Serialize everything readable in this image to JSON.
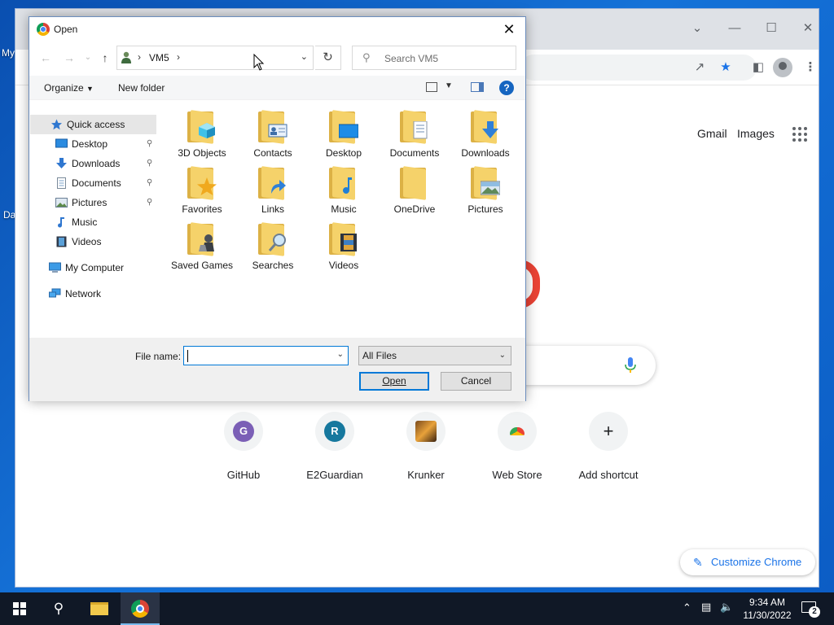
{
  "desktop": {
    "frag1": "My",
    "frag2": "Da"
  },
  "chrome": {
    "ntp": {
      "gmail": "Gmail",
      "images": "Images"
    },
    "shortcuts": [
      {
        "label": "GitHub",
        "letter": "G",
        "color": "#7b5fb6"
      },
      {
        "label": "E2Guardian",
        "letter": "R",
        "color": "#16789e"
      },
      {
        "label": "Krunker",
        "letter": "",
        "color": "#c77a2a"
      },
      {
        "label": "Web Store",
        "letter": "",
        "color": "#ea4335"
      },
      {
        "label": "Add shortcut",
        "letter": "+",
        "color": ""
      }
    ],
    "customize": "Customize Chrome"
  },
  "dialog": {
    "title": "Open",
    "address": {
      "crumb": "VM5"
    },
    "search_placeholder": "Search VM5",
    "toolbar": {
      "organize": "Organize",
      "new_folder": "New folder"
    },
    "nav": {
      "quick_access": "Quick access",
      "items": [
        "Desktop",
        "Downloads",
        "Documents",
        "Pictures",
        "Music",
        "Videos"
      ],
      "my_computer": "My Computer",
      "network": "Network"
    },
    "files": [
      "3D Objects",
      "Contacts",
      "Desktop",
      "Documents",
      "Downloads",
      "Favorites",
      "Links",
      "Music",
      "OneDrive",
      "Pictures",
      "Saved Games",
      "Searches",
      "Videos"
    ],
    "file_name_label": "File name:",
    "file_name_value": "",
    "file_type": "All Files",
    "open_label": "Open",
    "cancel_label": "Cancel"
  },
  "taskbar": {
    "time": "9:34 AM",
    "date": "11/30/2022",
    "notifications": "2"
  },
  "colors": {
    "accent": "#0078d7",
    "chrome_blue": "#1a73e8",
    "folder": "#f5d26a"
  }
}
